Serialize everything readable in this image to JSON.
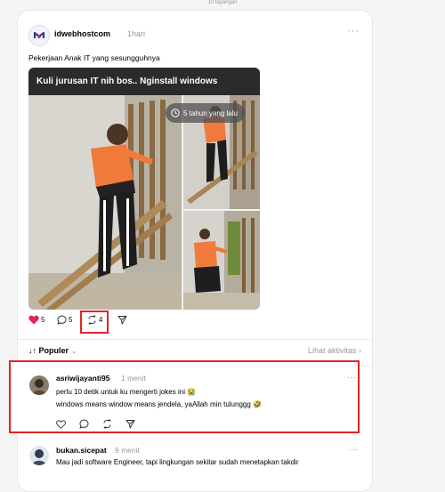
{
  "top_stub": "10 tayangan",
  "post": {
    "username": "idwebhostcom",
    "time": "1hari",
    "more": "···",
    "text": "Pekerjaan Anak IT yang sesungguhnya",
    "media_title": "Kuli jurusan IT nih bos.. Nginstall windows",
    "time_badge": "5 tahun yang lalu",
    "likes": "5",
    "comments": "5",
    "reposts": "4"
  },
  "sort": {
    "label": "Populer",
    "activity": "Lihat aktivitas"
  },
  "comments": [
    {
      "username": "asriwijayanti95",
      "time": "1 menit",
      "line1": "perlu 10 detik untuk ku mengerti jokes ini 😭",
      "line2": "windows means window means jendela, yaAllah min tulunggg 🤣",
      "more": "···"
    },
    {
      "username": "bukan.sicepat",
      "time": "9 menit",
      "line1": "Mau jadi software Engineer, tapi lingkungan sekitar sudah menetapkan takdir",
      "more": "···"
    }
  ],
  "colors": {
    "like": "#e0245e",
    "highlight": "#e02424",
    "muted": "#999999"
  }
}
